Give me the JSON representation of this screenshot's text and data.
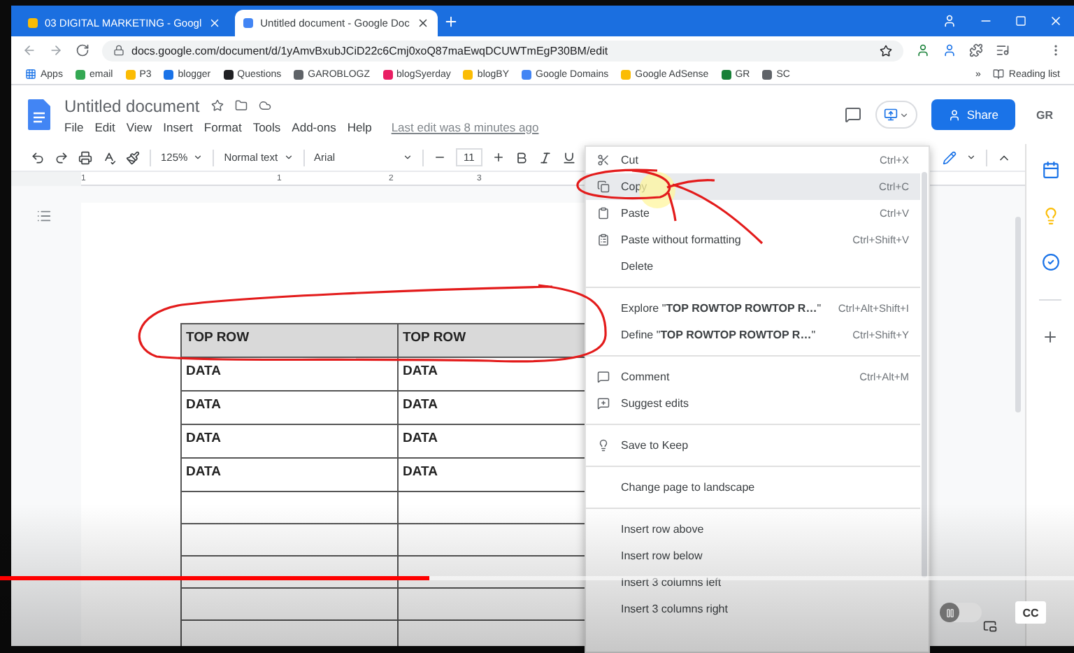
{
  "browser": {
    "tabs": [
      {
        "label": "03 DIGITAL MARKETING - Googl",
        "selected": false
      },
      {
        "label": "Untitled document - Google Doc",
        "selected": true
      }
    ],
    "url": "docs.google.com/document/d/1yAmvBxubJCiD22c6Cmj0xoQ87maEwqDCUWTmEgP30BM/edit",
    "bookmarks": [
      "Apps",
      "email",
      "P3",
      "blogger",
      "Questions",
      "GAROBLOGZ",
      "blogSyerday",
      "blogBY",
      "Google Domains",
      "Google AdSense",
      "GR",
      "SC"
    ],
    "more_bookmarks": "»",
    "reading_list": "Reading list"
  },
  "document": {
    "title": "Untitled document",
    "menus": [
      "File",
      "Edit",
      "View",
      "Insert",
      "Format",
      "Tools",
      "Add-ons",
      "Help"
    ],
    "last_edit": "Last edit was 8 minutes ago",
    "share": "Share",
    "avatar": "GR",
    "toolbar": {
      "zoom": "125%",
      "style": "Normal text",
      "font": "Arial",
      "size": "11"
    },
    "ruler": [
      "1",
      "1",
      "2",
      "3"
    ],
    "table": {
      "header": [
        "TOP ROW",
        "TOP ROW"
      ],
      "rows": [
        [
          "DATA",
          "DATA"
        ],
        [
          "DATA",
          "DATA"
        ],
        [
          "DATA",
          "DATA"
        ],
        [
          "DATA",
          "DATA"
        ]
      ]
    }
  },
  "context_menu": {
    "groups": [
      {
        "items": [
          {
            "label": "Cut",
            "shortcut": "Ctrl+X",
            "selected": false
          },
          {
            "label": "Copy",
            "shortcut": "Ctrl+C",
            "selected": true
          },
          {
            "label": "Paste",
            "shortcut": "Ctrl+V",
            "selected": false
          },
          {
            "label": "Paste without formatting",
            "shortcut": "Ctrl+Shift+V",
            "selected": false
          },
          {
            "label": "Delete",
            "selected": false
          }
        ]
      },
      {
        "items": [
          {
            "label": "Explore \"**TOP ROWTOP ROWTOP R…**\"",
            "shortcut": "Ctrl+Alt+Shift+I",
            "selected": false
          },
          {
            "label": "Define \"**TOP ROWTOP ROWTOP R…**\"",
            "shortcut": "Ctrl+Shift+Y",
            "selected": false
          }
        ]
      },
      {
        "items": [
          {
            "label": "Comment",
            "shortcut": "Ctrl+Alt+M",
            "selected": false
          },
          {
            "label": "Suggest edits",
            "selected": false
          }
        ]
      },
      {
        "items": [
          {
            "label": "Save to Keep",
            "selected": false
          }
        ]
      },
      {
        "items": [
          {
            "label": "Change page to landscape",
            "selected": false
          }
        ]
      },
      {
        "items": [
          {
            "label": "Insert row above",
            "selected": false
          },
          {
            "label": "Insert row below",
            "selected": false
          },
          {
            "label": "Insert 3 columns left",
            "selected": false
          },
          {
            "label": "Insert 3 columns right",
            "selected": false
          }
        ]
      }
    ]
  },
  "video_player": {
    "progress": {
      "level": 0.4
    },
    "autoplay": {
      "on": false
    },
    "captions": "CC"
  }
}
